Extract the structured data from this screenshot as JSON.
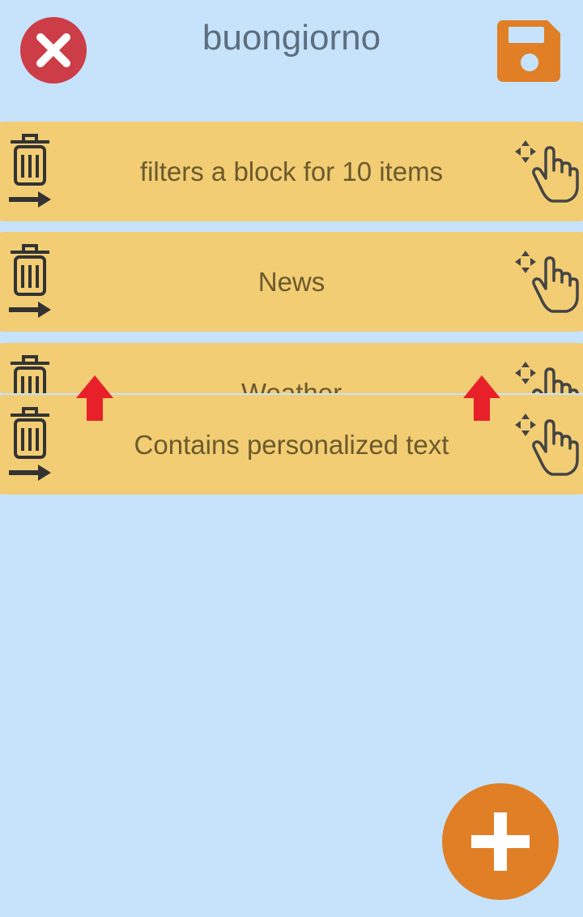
{
  "header": {
    "title": "buongiorno",
    "close_icon": "close-icon",
    "save_icon": "floppy-disk-save-icon"
  },
  "colors": {
    "background": "#c6e3fb",
    "card": "#f2cd74",
    "close": "#cc3d48",
    "accent": "#e07f26",
    "drop_indicator": "#e8202a"
  },
  "blocks": [
    {
      "label": "filters a block for 10 items"
    },
    {
      "label": "News"
    },
    {
      "label": "Weather"
    },
    {
      "label": "Contains personalized text"
    }
  ],
  "block_icons": {
    "delete": "trash-move-icon",
    "drag": "drag-hand-icon"
  },
  "fab": {
    "icon": "plus-icon"
  }
}
